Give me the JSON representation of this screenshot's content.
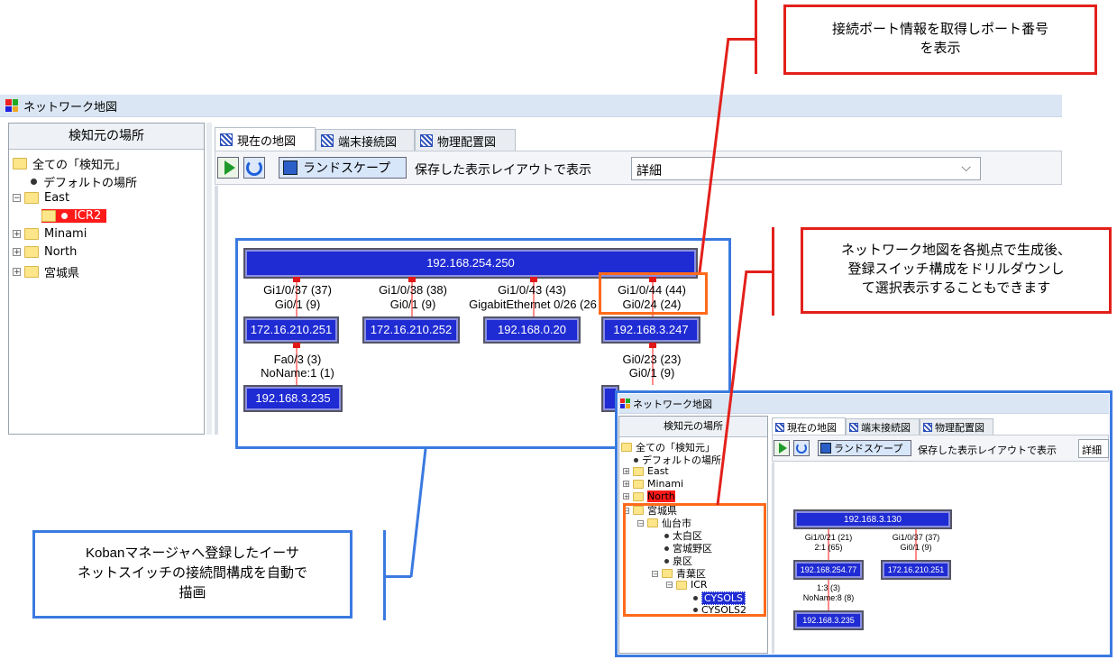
{
  "window": {
    "title": "ネットワーク地図"
  },
  "left_panel": {
    "header": "検知元の場所",
    "tree": {
      "root": "全ての「検知元」",
      "default": "デフォルトの場所",
      "east": "East",
      "icr2": "ICR2",
      "minami": "Minami",
      "north": "North",
      "miyagi": "宮城県"
    }
  },
  "tabs": [
    "現在の地図",
    "端末接続図",
    "物理配置図"
  ],
  "toolbar": {
    "landscape": "ランドスケープ",
    "saved_layout": "保存した表示レイアウトで表示",
    "detail_select": "詳細"
  },
  "map": {
    "root_node": "192.168.254.250",
    "nodes": [
      "172.16.210.251",
      "172.16.210.252",
      "192.168.0.20",
      "192.168.3.247",
      "192.168.3.235"
    ],
    "ports": {
      "p1a": "Gi1/0/37 (37)",
      "p1b": "Gi0/1 (9)",
      "p2a": "Gi1/0/38 (38)",
      "p2b": "Gi0/1 (9)",
      "p3a": "Gi1/0/43 (43)",
      "p3b": "GigabitEthernet 0/26 (26",
      "p4a": "Gi1/0/44 (44)",
      "p4b": "Gi0/24 (24)",
      "p5a": "Fa0/3 (3)",
      "p5b": "NoName:1 (1)",
      "p6a": "Gi0/23 (23)",
      "p6b": "Gi0/1 (9)"
    }
  },
  "inset": {
    "title": "ネットワーク地図",
    "header": "検知元の場所",
    "tabs": [
      "現在の地図",
      "端末接続図",
      "物理配置図"
    ],
    "toolbar": {
      "landscape": "ランドスケープ",
      "saved_layout": "保存した表示レイアウトで表示",
      "detail": "詳細"
    },
    "tree": {
      "root": "全ての「検知元」",
      "default": "デフォルトの場所",
      "east": "East",
      "minami": "Minami",
      "north": "North",
      "miyagi": "宮城県",
      "sendai": "仙台市",
      "taihaku": "太白区",
      "miyagino": "宮城野区",
      "izumi": "泉区",
      "aoba": "青葉区",
      "icr": "ICR",
      "cysols": "CYSOLS",
      "cysols2": "CYSOLS2"
    },
    "map": {
      "root_node": "192.168.3.130",
      "nodes": [
        "192.168.254.77",
        "172.16.210.251",
        "192.168.3.235"
      ],
      "ports": {
        "a1": "Gi1/0/21 (21)",
        "a2": "2:1 (65)",
        "b1": "Gi1/0/37 (37)",
        "b2": "Gi0/1 (9)",
        "c1": "1:3 (3)",
        "c2": "NoName:8 (8)"
      }
    }
  },
  "callouts": {
    "top_right": [
      "接続ポート情報を取得しポート番号",
      "を表示"
    ],
    "mid_right": [
      "ネットワーク地図を各拠点で生成後、",
      "登録スイッチ構成をドリルダウンし",
      "て選択表示することもできます"
    ],
    "bottom_left": [
      "Kobanマネージャへ登録したイーサ",
      "ネットスイッチの接続間構成を自動で",
      "描画"
    ]
  },
  "colors": {
    "accent_red": "#e3201b",
    "accent_blue": "#3a7ae0",
    "node_blue": "#1f2bd3"
  }
}
